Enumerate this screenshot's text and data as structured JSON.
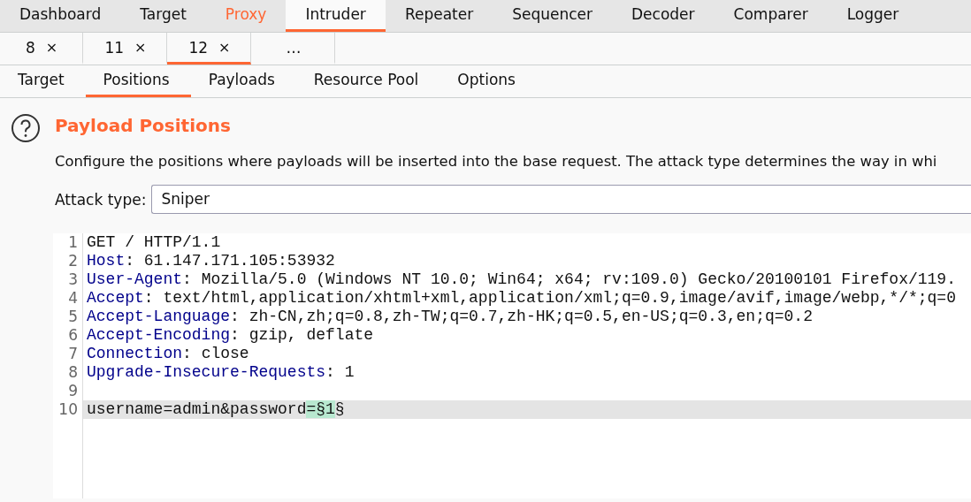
{
  "main_tabs": [
    {
      "label": "Dashboard",
      "selected": false,
      "highlighted": false
    },
    {
      "label": "Target",
      "selected": false,
      "highlighted": false
    },
    {
      "label": "Proxy",
      "selected": false,
      "highlighted": true
    },
    {
      "label": "Intruder",
      "selected": true,
      "highlighted": false
    },
    {
      "label": "Repeater",
      "selected": false,
      "highlighted": false
    },
    {
      "label": "Sequencer",
      "selected": false,
      "highlighted": false
    },
    {
      "label": "Decoder",
      "selected": false,
      "highlighted": false
    },
    {
      "label": "Comparer",
      "selected": false,
      "highlighted": false
    },
    {
      "label": "Logger",
      "selected": false,
      "highlighted": false
    }
  ],
  "attack_tabs": [
    {
      "label": "8",
      "close": "×",
      "selected": false
    },
    {
      "label": "11",
      "close": "×",
      "selected": false
    },
    {
      "label": "12",
      "close": "×",
      "selected": true
    },
    {
      "label": "…",
      "selected": false
    }
  ],
  "sub_tabs": [
    {
      "label": "Target",
      "selected": false
    },
    {
      "label": "Positions",
      "selected": true
    },
    {
      "label": "Payloads",
      "selected": false
    },
    {
      "label": "Resource Pool",
      "selected": false
    },
    {
      "label": "Options",
      "selected": false
    }
  ],
  "section": {
    "title": "Payload Positions",
    "description": "Configure the positions where payloads will be inserted into the base request. The attack type determines the way in whi"
  },
  "attack_type": {
    "label": "Attack type:",
    "value": "Sniper"
  },
  "request_editor": {
    "lines": [
      {
        "number": "1",
        "kind": "plain",
        "text": "GET / HTTP/1.1",
        "current": false
      },
      {
        "number": "2",
        "kind": "header",
        "name": "Host",
        "value": ": 61.147.171.105:53932",
        "current": false
      },
      {
        "number": "3",
        "kind": "header",
        "name": "User-Agent",
        "value": ": Mozilla/5.0 (Windows NT 10.0; Win64; x64; rv:109.0) Gecko/20100101 Firefox/119.",
        "current": false
      },
      {
        "number": "4",
        "kind": "header",
        "name": "Accept",
        "value": ": text/html,application/xhtml+xml,application/xml;q=0.9,image/avif,image/webp,*/*;q=0",
        "current": false
      },
      {
        "number": "5",
        "kind": "header",
        "name": "Accept-Language",
        "value": ": zh-CN,zh;q=0.8,zh-TW;q=0.7,zh-HK;q=0.5,en-US;q=0.3,en;q=0.2",
        "current": false
      },
      {
        "number": "6",
        "kind": "header",
        "name": "Accept-Encoding",
        "value": ": gzip, deflate",
        "current": false
      },
      {
        "number": "7",
        "kind": "header",
        "name": "Connection",
        "value": ": close",
        "current": false
      },
      {
        "number": "8",
        "kind": "header",
        "name": "Upgrade-Insecure-Requests",
        "value": ": 1",
        "current": false
      },
      {
        "number": "9",
        "kind": "blank",
        "current": false
      },
      {
        "number": "10",
        "kind": "body",
        "current": true,
        "segments": [
          {
            "text": "username=admin&password",
            "marked": false
          },
          {
            "text": "=§1",
            "marked": true
          },
          {
            "text": "§",
            "marked": false
          }
        ]
      }
    ]
  }
}
